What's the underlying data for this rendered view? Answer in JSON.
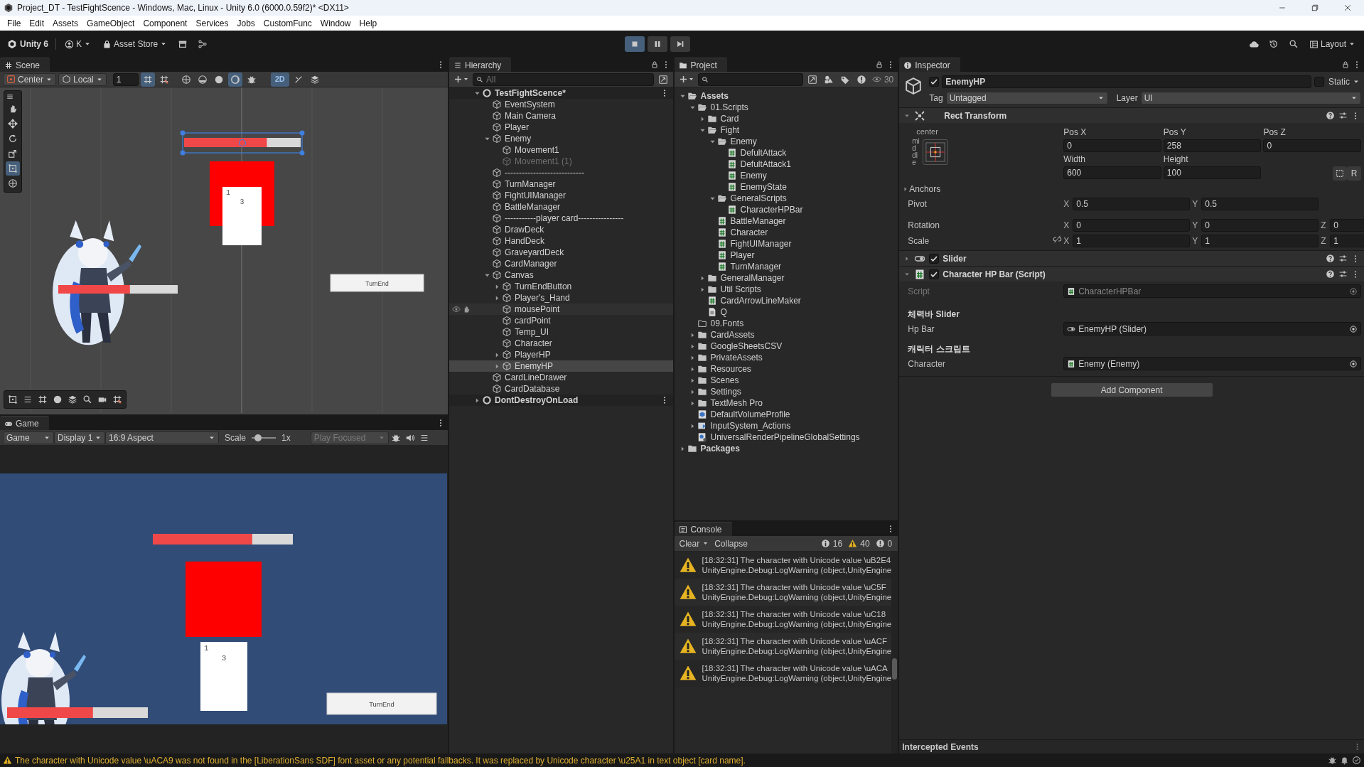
{
  "window": {
    "title": "Project_DT - TestFightScence - Windows, Mac, Linux - Unity 6.0 (6000.0.59f2)* <DX11>"
  },
  "menu": [
    "File",
    "Edit",
    "Assets",
    "GameObject",
    "Component",
    "Services",
    "Jobs",
    "CustomFunc",
    "Window",
    "Help"
  ],
  "toolbar": {
    "product": "Unity 6",
    "account": "K",
    "store": "Asset Store",
    "playing": true,
    "layout": "Layout"
  },
  "scene": {
    "tab": "Scene",
    "pivot": "Center",
    "space": "Local",
    "grid_size": "1",
    "shading": [
      {
        "selected": false
      },
      {
        "selected": false
      },
      {
        "selected": false
      },
      {
        "selected": true
      }
    ],
    "mode_2d": {
      "label": "2D",
      "on": true
    },
    "tools": [
      {
        "kind": "view",
        "selected": false
      },
      {
        "kind": "move",
        "selected": false
      },
      {
        "kind": "rotate",
        "selected": false
      },
      {
        "kind": "scale",
        "selected": false
      },
      {
        "kind": "rect",
        "selected": true
      },
      {
        "kind": "transform",
        "selected": false
      }
    ],
    "view": {
      "enemy_hp": {
        "level": 0.71
      },
      "player_hp": {
        "level": 0.6
      },
      "card": {
        "cost": "1",
        "value": "3"
      },
      "button": "TurnEnd"
    }
  },
  "game": {
    "tab": "Game",
    "mode": "Game",
    "display": "Display 1",
    "aspect": "16:9 Aspect",
    "scale_label": "Scale",
    "scale": {
      "level": 0.15
    },
    "scale_value": "1x",
    "play_mode": "Play Focused",
    "view": {
      "enemy_hp": {
        "level": 0.71
      },
      "player_hp": {
        "level": 0.61
      },
      "card": {
        "cost": "1",
        "value": "3"
      },
      "button": "TurnEnd"
    }
  },
  "hierarchy": {
    "tab": "Hierarchy",
    "placeholder": "All",
    "roots": [
      {
        "name": "TestFightScence*",
        "kind": "scene",
        "expanded": true,
        "children": [
          {
            "name": "EventSystem",
            "selected": false,
            "disabled": false,
            "hovered": false
          },
          {
            "name": "Main Camera",
            "selected": false,
            "disabled": false,
            "hovered": false
          },
          {
            "name": "Player",
            "selected": false,
            "disabled": false,
            "hovered": false
          },
          {
            "name": "Enemy",
            "selected": false,
            "disabled": false,
            "hovered": false,
            "expanded": true,
            "children": [
              {
                "name": "Movement1",
                "selected": false,
                "disabled": false,
                "hovered": false
              },
              {
                "name": "Movement1 (1)",
                "selected": false,
                "disabled": true,
                "hovered": false
              }
            ]
          },
          {
            "name": "----------------------------",
            "selected": false,
            "disabled": false,
            "hovered": false
          },
          {
            "name": "TurnManager",
            "selected": false,
            "disabled": false,
            "hovered": false
          },
          {
            "name": "FightUIManager",
            "selected": false,
            "disabled": false,
            "hovered": false
          },
          {
            "name": "BattleManager",
            "selected": false,
            "disabled": false,
            "hovered": false
          },
          {
            "name": "-----------player card----------------",
            "selected": false,
            "disabled": false,
            "hovered": false
          },
          {
            "name": "DrawDeck",
            "selected": false,
            "disabled": false,
            "hovered": false
          },
          {
            "name": "HandDeck",
            "selected": false,
            "disabled": false,
            "hovered": false
          },
          {
            "name": "GraveyardDeck",
            "selected": false,
            "disabled": false,
            "hovered": false
          },
          {
            "name": "CardManager",
            "selected": false,
            "disabled": false,
            "hovered": false
          },
          {
            "name": "Canvas",
            "selected": false,
            "disabled": false,
            "hovered": false,
            "expanded": true,
            "children": [
              {
                "name": "TurnEndButton",
                "selected": false,
                "disabled": false,
                "hovered": false,
                "expanded": false
              },
              {
                "name": "Player's_Hand",
                "selected": false,
                "disabled": false,
                "hovered": false,
                "expanded": false
              },
              {
                "name": "mousePoint",
                "selected": false,
                "disabled": false,
                "hovered": true
              },
              {
                "name": "cardPoint",
                "selected": false,
                "disabled": false,
                "hovered": false
              },
              {
                "name": "Temp_UI",
                "selected": false,
                "disabled": false,
                "hovered": false
              },
              {
                "name": "Character",
                "selected": false,
                "disabled": false,
                "hovered": false
              },
              {
                "name": "PlayerHP",
                "selected": false,
                "disabled": false,
                "hovered": false,
                "expanded": false
              },
              {
                "name": "EnemyHP",
                "selected": true,
                "disabled": false,
                "hovered": false,
                "expanded": false
              }
            ]
          },
          {
            "name": "CardLineDrawer",
            "selected": false,
            "disabled": false,
            "hovered": false
          },
          {
            "name": "CardDatabase",
            "selected": false,
            "disabled": false,
            "hovered": false
          }
        ]
      },
      {
        "name": "DontDestroyOnLoad",
        "kind": "scene",
        "expanded": false
      }
    ]
  },
  "project": {
    "tab": "Project",
    "count": "30",
    "tree": [
      {
        "name": "Assets",
        "kind": "folder",
        "expanded": true,
        "children": [
          {
            "name": "01.Scripts",
            "kind": "folder",
            "expanded": true,
            "children": [
              {
                "name": "Card",
                "kind": "folder",
                "expanded": false
              },
              {
                "name": "Fight",
                "kind": "folder",
                "expanded": true,
                "children": [
                  {
                    "name": "Enemy",
                    "kind": "folder",
                    "expanded": true,
                    "children": [
                      {
                        "name": "DefultAttack",
                        "kind": "script"
                      },
                      {
                        "name": "DefultAttack1",
                        "kind": "script"
                      },
                      {
                        "name": "Enemy",
                        "kind": "script"
                      },
                      {
                        "name": "EnemyState",
                        "kind": "script"
                      }
                    ]
                  },
                  {
                    "name": "GeneralScripts",
                    "kind": "folder",
                    "expanded": true,
                    "children": [
                      {
                        "name": "CharacterHPBar",
                        "kind": "script"
                      }
                    ]
                  },
                  {
                    "name": "BattleManager",
                    "kind": "script"
                  },
                  {
                    "name": "Character",
                    "kind": "script"
                  },
                  {
                    "name": "FightUIManager",
                    "kind": "script"
                  },
                  {
                    "name": "Player",
                    "kind": "script"
                  },
                  {
                    "name": "TurnManager",
                    "kind": "script"
                  }
                ]
              },
              {
                "name": "GeneralManager",
                "kind": "folder",
                "expanded": false
              },
              {
                "name": "Util Scripts",
                "kind": "folder",
                "expanded": false
              },
              {
                "name": "CardArrowLineMaker",
                "kind": "script"
              },
              {
                "name": "Q",
                "kind": "text"
              }
            ]
          },
          {
            "name": "09.Fonts",
            "kind": "empty_folder"
          },
          {
            "name": "CardAssets",
            "kind": "folder",
            "expanded": false
          },
          {
            "name": "GoogleSheetsCSV",
            "kind": "folder",
            "expanded": false
          },
          {
            "name": "PrivateAssets",
            "kind": "folder",
            "expanded": false
          },
          {
            "name": "Resources",
            "kind": "folder",
            "expanded": false
          },
          {
            "name": "Scenes",
            "kind": "folder",
            "expanded": false
          },
          {
            "name": "Settings",
            "kind": "folder",
            "expanded": false
          },
          {
            "name": "TextMesh Pro",
            "kind": "folder",
            "expanded": false
          },
          {
            "name": "DefaultVolumeProfile",
            "kind": "volume"
          },
          {
            "name": "InputSystem_Actions",
            "kind": "input_actions",
            "expanded": false
          },
          {
            "name": "UniversalRenderPipelineGlobalSettings",
            "kind": "settings"
          }
        ]
      },
      {
        "name": "Packages",
        "kind": "folder",
        "expanded": false
      }
    ]
  },
  "inspector": {
    "tab": "Inspector",
    "object": {
      "active": true,
      "name": "EnemyHP",
      "static": false,
      "static_label": "Static",
      "tag_label": "Tag",
      "tag": "Untagged",
      "layer_label": "Layer",
      "layer": "UI"
    },
    "rect_transform": {
      "title": "Rect Transform",
      "expanded": true,
      "anchor_h": "center",
      "anchor_v": "middle",
      "pos": [
        {
          "label": "Pos X",
          "value": "0"
        },
        {
          "label": "Pos Y",
          "value": "258"
        },
        {
          "label": "Pos Z",
          "value": "0"
        }
      ],
      "size": [
        {
          "label": "Width",
          "value": "600"
        },
        {
          "label": "Height",
          "value": "100"
        }
      ],
      "raw_button": "R",
      "anchors": "Anchors",
      "anchors_expanded": false,
      "rows": [
        {
          "label": "Pivot",
          "kind": "pivot",
          "axes": [
            {
              "axis": "X",
              "value": "0.5"
            },
            {
              "axis": "Y",
              "value": "0.5"
            }
          ]
        },
        {
          "label": "Rotation",
          "kind": "vector",
          "axes": [
            {
              "axis": "X",
              "value": "0"
            },
            {
              "axis": "Y",
              "value": "0"
            },
            {
              "axis": "Z",
              "value": "0"
            }
          ]
        },
        {
          "label": "Scale",
          "kind": "scale",
          "axes": [
            {
              "axis": "X",
              "value": "1"
            },
            {
              "axis": "Y",
              "value": "1"
            },
            {
              "axis": "Z",
              "value": "1"
            }
          ]
        }
      ]
    },
    "components": [
      {
        "kind": "slider",
        "title": "Slider",
        "enabled": true,
        "expanded": false
      },
      {
        "kind": "script",
        "title": "Character HP Bar (Script)",
        "enabled": true,
        "expanded": true,
        "script_label": "Script",
        "script": "CharacterHPBar",
        "groups": [
          {
            "header": "체력바 Slider",
            "label": "Hp Bar",
            "value": "EnemyHP (Slider)",
            "kind": "slider"
          },
          {
            "header": "캐릭터 스크립트",
            "label": "Character",
            "value": "Enemy (Enemy)",
            "kind": "script"
          }
        ]
      }
    ],
    "add_component": "Add Component",
    "footer": "Intercepted Events"
  },
  "console": {
    "tab": "Console",
    "clear": "Clear",
    "collapse": "Collapse",
    "counts": {
      "info": "16",
      "warning": "40",
      "error": "0"
    },
    "messages": [
      {
        "kind": "warning",
        "line1": "[18:32:31] The character with Unicode value \\uB2E4",
        "line2": "UnityEngine.Debug:LogWarning (object,UnityEngine"
      },
      {
        "kind": "warning",
        "line1": "[18:32:31] The character with Unicode value \\uC5F",
        "line2": "UnityEngine.Debug:LogWarning (object,UnityEngine"
      },
      {
        "kind": "warning",
        "line1": "[18:32:31] The character with Unicode value \\uC18",
        "line2": "UnityEngine.Debug:LogWarning (object,UnityEngine"
      },
      {
        "kind": "warning",
        "line1": "[18:32:31] The character with Unicode value \\uACF",
        "line2": "UnityEngine.Debug:LogWarning (object,UnityEngine"
      },
      {
        "kind": "warning",
        "line1": "[18:32:31] The character with Unicode value \\uACA",
        "line2": "UnityEngine.Debug:LogWarning (object,UnityEngine"
      }
    ]
  },
  "status_bar": {
    "kind": "warning",
    "text": "The character with Unicode value \\uACA9 was not found in the [LiberationSans SDF] font asset or any potential fallbacks. It was replaced by Unicode character \\u25A1 in text object [card name]."
  }
}
